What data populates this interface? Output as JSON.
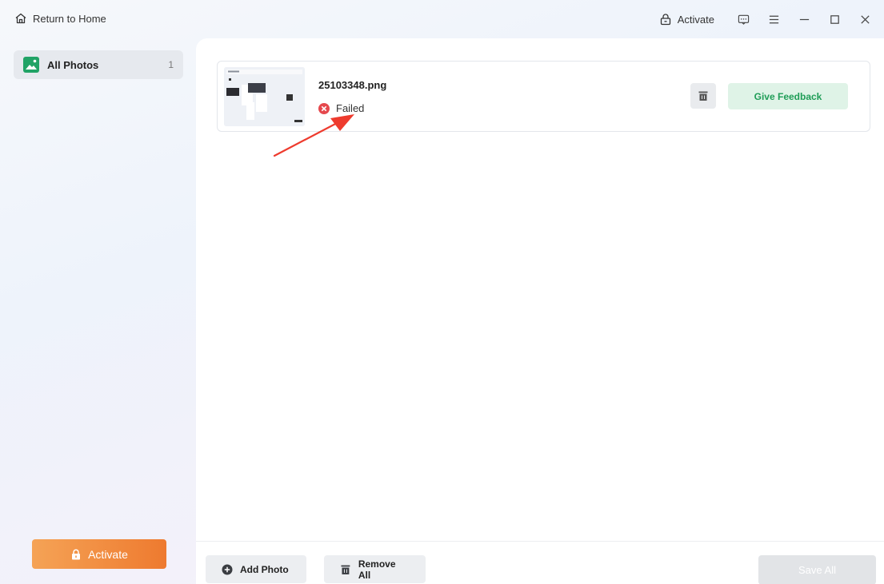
{
  "header": {
    "home_label": "Return to Home",
    "activate_label": "Activate"
  },
  "sidebar": {
    "items": [
      {
        "label": "All Photos",
        "count": "1"
      }
    ],
    "activate_label": "Activate"
  },
  "files": [
    {
      "name": "25103348.png",
      "status": "Failed",
      "feedback_label": "Give Feedback"
    }
  ],
  "footer": {
    "add_label": "Add Photo",
    "remove_label": "Remove All",
    "save_label": "Save All"
  },
  "colors": {
    "accent_green": "#21a366",
    "failed_red": "#e5484d",
    "activate_orange": "#ee7a2f",
    "annotation_arrow": "#ee3b2e"
  }
}
